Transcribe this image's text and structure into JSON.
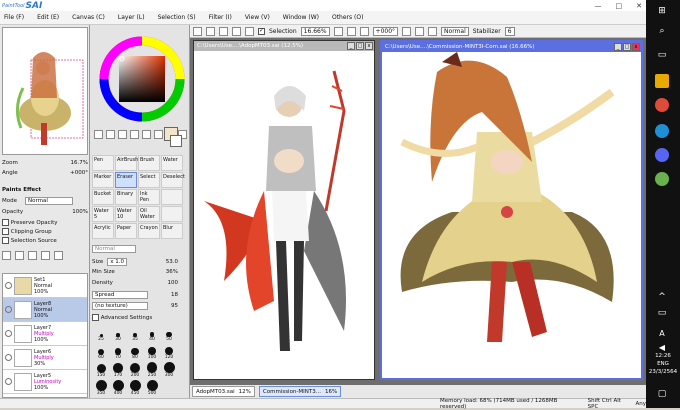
{
  "app": {
    "logo_small": "PaintTool",
    "logo_big": "SAI"
  },
  "window_controls": [
    "—",
    "□",
    "✕"
  ],
  "menu": [
    "File (F)",
    "Edit (E)",
    "Canvas (C)",
    "Layer (L)",
    "Selection (S)",
    "Filter (I)",
    "View (V)",
    "Window (W)",
    "Others (O)"
  ],
  "toolbar": {
    "selection_label": "Selection",
    "zoom": "16.66%",
    "rotation": "+000°",
    "mode": "Normal",
    "stabilizer_label": "Stabilizer",
    "stabilizer_value": "6"
  },
  "navigator": {
    "zoom_label": "Zoom",
    "zoom_value": "16.7%",
    "angle_label": "Angle",
    "angle_value": "+000°"
  },
  "paint_effect": {
    "header": "Paints Effect",
    "mode_label": "Mode",
    "mode_value": "Normal",
    "opacity_label": "Opacity",
    "opacity_value": "100%",
    "preserve_opacity": "Preserve Opacity",
    "clipping_group": "Clipping Group",
    "selection_source": "Selection Source"
  },
  "layers": [
    {
      "name": "Set1",
      "blend": "Normal",
      "opacity": "100%",
      "selected": false
    },
    {
      "name": "Layer8",
      "blend": "Normal",
      "opacity": "100%",
      "selected": true
    },
    {
      "name": "Layer7",
      "blend": "Multiply",
      "opacity": "100%",
      "selected": false
    },
    {
      "name": "Layer6",
      "blend": "Multiply",
      "opacity": "30%",
      "selected": false
    },
    {
      "name": "Layer5",
      "blend": "Luminosity",
      "opacity": "100%",
      "selected": false
    }
  ],
  "tools": [
    "Pen",
    "AirBrush",
    "Brush",
    "Water",
    "Marker",
    "Eraser",
    "Select",
    "Deselect",
    "Bucket",
    "Binary",
    "Ink Pen",
    "",
    "Water 5",
    "Water 10",
    "Oil Water",
    "",
    "Acrylic",
    "Paper",
    "Crayon",
    "Blur"
  ],
  "brush_settings": {
    "blend_mode": "Normal",
    "size_label": "Size",
    "size_mult": "x 1.0",
    "size_value": "53.0",
    "min_size_label": "Min Size",
    "min_size_value": "36%",
    "density_label": "Density",
    "density_value": "100",
    "shape": "Spread",
    "shape_value": "18",
    "texture": "(no texture)",
    "texture_value": "95",
    "advanced": "Advanced Settings"
  },
  "brush_sizes": [
    "25",
    "30",
    "35",
    "40",
    "50",
    "60",
    "70",
    "80",
    "100",
    "120",
    "150",
    "170",
    "200",
    "250",
    "300",
    "350",
    "400",
    "450",
    "500"
  ],
  "documents": [
    {
      "title": "C:\\Users\\Use....\\AdopMT03.sai (12.5%)",
      "active": false
    },
    {
      "title": "C:\\Users\\Use....\\Commission-MINT3I-Com.sai (16.66%)",
      "active": true
    }
  ],
  "tabs": [
    {
      "name": "AdopMT03.sai",
      "zoom": "12%"
    },
    {
      "name": "Commission-MINT3...",
      "zoom": "16%"
    }
  ],
  "status": {
    "memory": "Memory load: 68% (714MB used / 1268MB reserved)",
    "keys": "Shift Ctrl Alt SPC",
    "extra": "Any"
  },
  "taskbar": {
    "time": "12:26",
    "lang": "ENG",
    "date": "23/3/2564"
  },
  "colors": {
    "accent": "#6b8ed6",
    "doc_active": "#5b6fe0",
    "doc_inactive": "#b9b9b9"
  }
}
